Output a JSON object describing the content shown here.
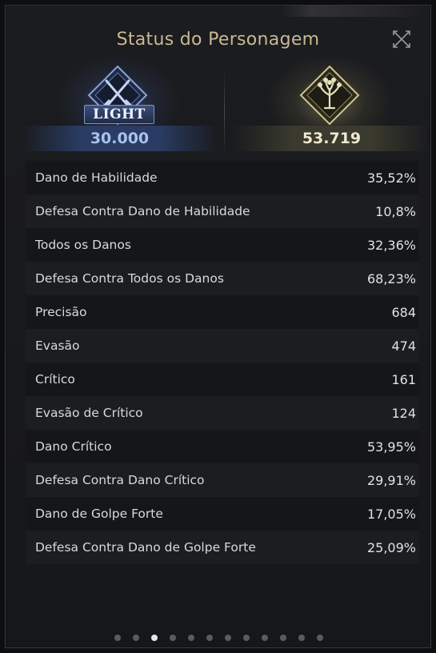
{
  "window": {
    "title": "Status do Personagem"
  },
  "emblems": {
    "left": {
      "badge": "LIGHT",
      "score": "30.000",
      "accent": "#6f8fd6",
      "icon": "crossed-swords-icon"
    },
    "right": {
      "score": "53.719",
      "accent": "#cfc58a",
      "icon": "tree-icon"
    }
  },
  "stats": [
    {
      "label": "Dano de Habilidade",
      "value": "35,52%"
    },
    {
      "label": "Defesa Contra Dano de Habilidade",
      "value": "10,8%"
    },
    {
      "label": "Todos os Danos",
      "value": "32,36%"
    },
    {
      "label": "Defesa Contra Todos os Danos",
      "value": "68,23%"
    },
    {
      "label": "Precisão",
      "value": "684"
    },
    {
      "label": "Evasão",
      "value": "474"
    },
    {
      "label": "Crítico",
      "value": "161"
    },
    {
      "label": "Evasão de Crítico",
      "value": "124"
    },
    {
      "label": "Dano Crítico",
      "value": "53,95%"
    },
    {
      "label": "Defesa Contra Dano Crítico",
      "value": "29,91%"
    },
    {
      "label": "Dano de Golpe Forte",
      "value": "17,05%"
    },
    {
      "label": "Defesa Contra Dano de Golpe Forte",
      "value": "25,09%"
    }
  ],
  "pagination": {
    "total": 12,
    "current": 3
  },
  "colors": {
    "title": "#c9b895",
    "active_dot": "#e6e6e6",
    "inactive_dot": "#5a5b5f"
  }
}
